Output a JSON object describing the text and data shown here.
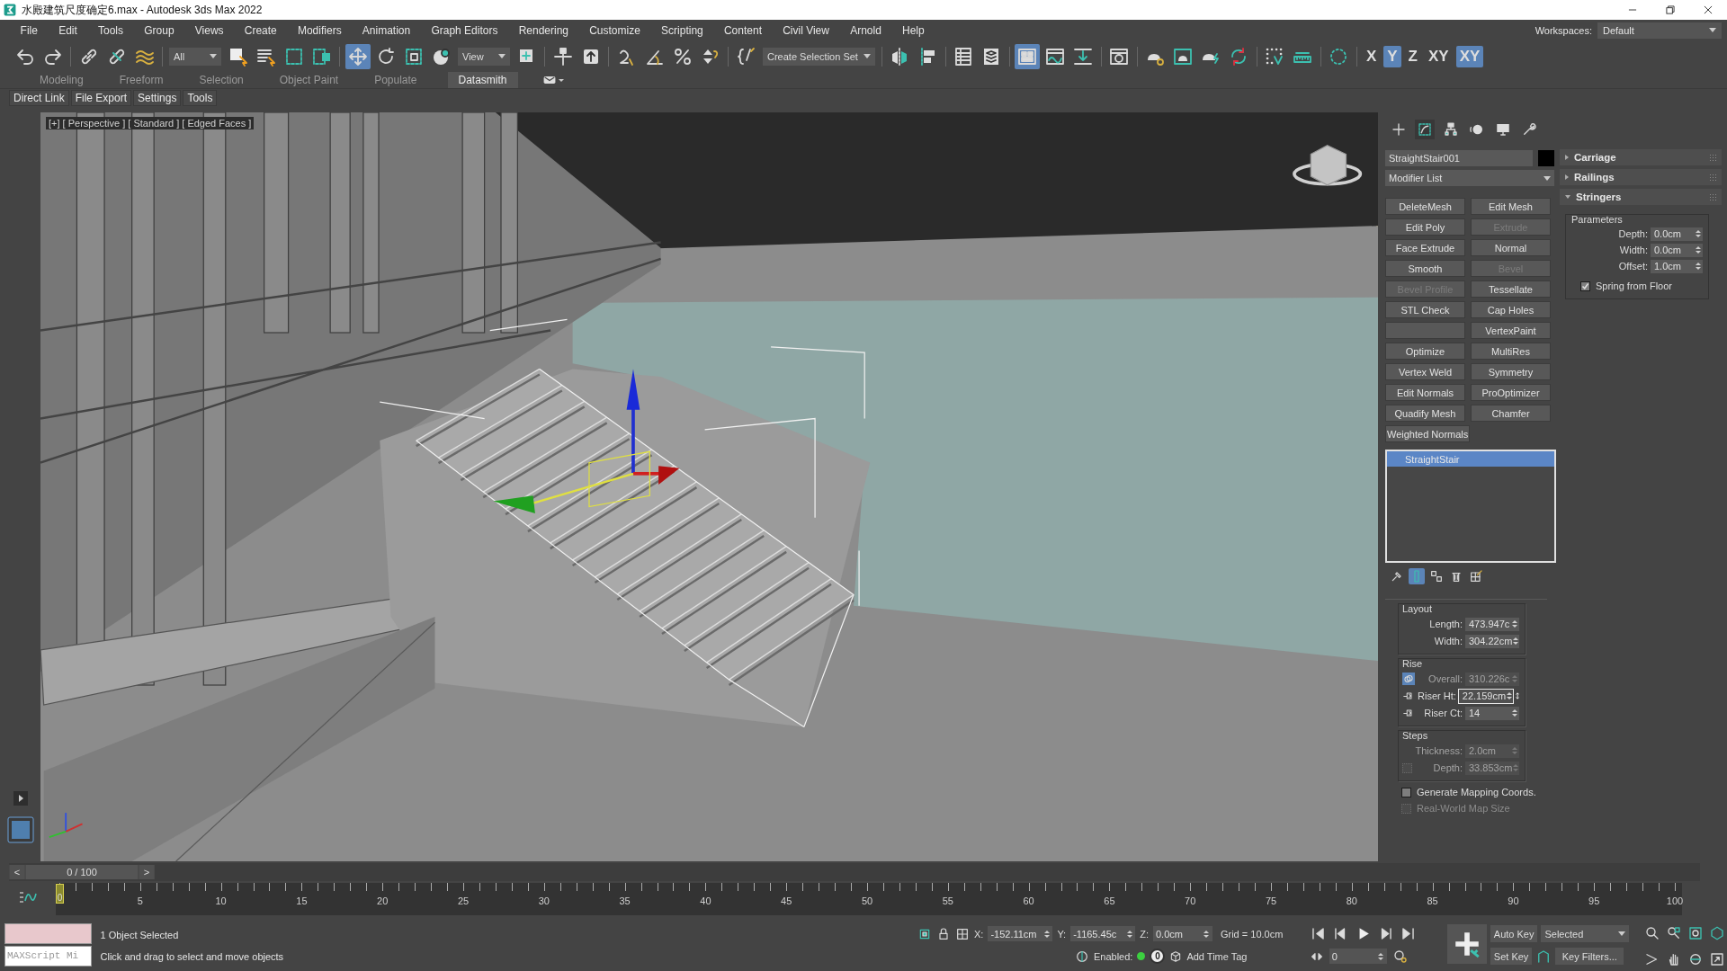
{
  "window": {
    "title": "水殿建筑尺度确定6.max - Autodesk 3ds Max 2022"
  },
  "menu": [
    "File",
    "Edit",
    "Tools",
    "Group",
    "Views",
    "Create",
    "Modifiers",
    "Animation",
    "Graph Editors",
    "Rendering",
    "Customize",
    "Scripting",
    "Content",
    "Civil View",
    "Arnold",
    "Help"
  ],
  "workspaces": {
    "label": "Workspaces:",
    "value": "Default"
  },
  "toolbar": [
    {
      "kind": "icon",
      "selected": false
    },
    {
      "kind": "icon",
      "selected": false
    },
    {
      "kind": "sep"
    },
    {
      "kind": "icon",
      "selected": false
    },
    {
      "kind": "icon",
      "selected": false
    },
    {
      "kind": "icon",
      "selected": false
    },
    {
      "kind": "sep"
    },
    {
      "kind": "dropdown",
      "value": "All"
    },
    {
      "kind": "icon",
      "selected": false
    },
    {
      "kind": "icon",
      "selected": false
    },
    {
      "kind": "icon",
      "selected": false
    },
    {
      "kind": "icon",
      "selected": false
    },
    {
      "kind": "sep"
    },
    {
      "kind": "icon",
      "selected": true
    },
    {
      "kind": "icon",
      "selected": false
    },
    {
      "kind": "icon",
      "selected": false
    },
    {
      "kind": "icon",
      "selected": false
    },
    {
      "kind": "dropdown",
      "value": "View"
    },
    {
      "kind": "icon",
      "selected": false
    },
    {
      "kind": "sep"
    },
    {
      "kind": "icon",
      "selected": false
    },
    {
      "kind": "icon",
      "selected": false
    },
    {
      "kind": "sep"
    },
    {
      "kind": "icon",
      "selected": false
    },
    {
      "kind": "icon",
      "selected": false
    },
    {
      "kind": "icon",
      "selected": false
    },
    {
      "kind": "icon",
      "selected": false
    },
    {
      "kind": "sep"
    },
    {
      "kind": "icon",
      "selected": false
    },
    {
      "kind": "dropdown",
      "value": "Create Selection Set"
    },
    {
      "kind": "sep"
    },
    {
      "kind": "icon",
      "selected": false
    },
    {
      "kind": "icon",
      "selected": false
    },
    {
      "kind": "sep"
    },
    {
      "kind": "icon",
      "selected": false
    },
    {
      "kind": "icon",
      "selected": false
    },
    {
      "kind": "sep"
    },
    {
      "kind": "icon",
      "selected": true
    },
    {
      "kind": "icon",
      "selected": false
    },
    {
      "kind": "icon",
      "selected": false
    },
    {
      "kind": "sep"
    },
    {
      "kind": "icon",
      "selected": false
    },
    {
      "kind": "sep"
    },
    {
      "kind": "icon",
      "selected": false
    },
    {
      "kind": "icon",
      "selected": false
    },
    {
      "kind": "icon",
      "selected": false
    },
    {
      "kind": "icon",
      "selected": false
    },
    {
      "kind": "sep"
    },
    {
      "kind": "icon",
      "selected": false
    },
    {
      "kind": "icon",
      "selected": false
    },
    {
      "kind": "sep"
    },
    {
      "kind": "icon",
      "selected": false
    },
    {
      "kind": "sep"
    },
    {
      "kind": "axis",
      "label": "X",
      "selected": false
    },
    {
      "kind": "axis",
      "label": "Y",
      "selected": true
    },
    {
      "kind": "axis",
      "label": "Z",
      "selected": false
    },
    {
      "kind": "axis",
      "label": "XY",
      "selected": false
    },
    {
      "kind": "axis",
      "label": "XY",
      "selected": true
    }
  ],
  "ribbon_tabs": [
    {
      "label": "Modeling",
      "selected": false
    },
    {
      "label": "Freeform",
      "selected": false
    },
    {
      "label": "Selection",
      "selected": false
    },
    {
      "label": "Object Paint",
      "selected": false
    },
    {
      "label": "Populate",
      "selected": false
    },
    {
      "label": "Datasmith",
      "selected": true
    }
  ],
  "datasmith_buttons": [
    "Direct Link",
    "File Export",
    "Settings",
    "Tools"
  ],
  "viewport": {
    "label": "[+] [ Perspective ] [ Standard ] [ Edged Faces ]"
  },
  "command_panel": {
    "tabs": [
      {
        "selected": false
      },
      {
        "selected": true
      },
      {
        "selected": false
      },
      {
        "selected": false
      },
      {
        "selected": false
      },
      {
        "selected": false
      }
    ],
    "object_name": "StraightStair001",
    "modifier_list": "Modifier List",
    "modifier_buttons": [
      {
        "kind": "button",
        "label": "DeleteMesh",
        "disabled": false
      },
      {
        "kind": "button",
        "label": "Edit Mesh",
        "disabled": false
      },
      {
        "kind": "button",
        "label": "Edit Poly",
        "disabled": false
      },
      {
        "kind": "button",
        "label": "Extrude",
        "disabled": true
      },
      {
        "kind": "button",
        "label": "Face Extrude",
        "disabled": false
      },
      {
        "kind": "button",
        "label": "Normal",
        "disabled": false
      },
      {
        "kind": "button",
        "label": "Smooth",
        "disabled": false
      },
      {
        "kind": "button",
        "label": "Bevel",
        "disabled": true
      },
      {
        "kind": "button",
        "label": "Bevel Profile",
        "disabled": true
      },
      {
        "kind": "button",
        "label": "Tessellate",
        "disabled": false
      },
      {
        "kind": "button",
        "label": "STL Check",
        "disabled": false
      },
      {
        "kind": "button",
        "label": "Cap Holes",
        "disabled": false
      },
      {
        "kind": "blank"
      },
      {
        "kind": "button",
        "label": "VertexPaint",
        "disabled": false
      },
      {
        "kind": "button",
        "label": "Optimize",
        "disabled": false
      },
      {
        "kind": "button",
        "label": "MultiRes",
        "disabled": false
      },
      {
        "kind": "button",
        "label": "Vertex Weld",
        "disabled": false
      },
      {
        "kind": "button",
        "label": "Symmetry",
        "disabled": false
      },
      {
        "kind": "button",
        "label": "Edit Normals",
        "disabled": false
      },
      {
        "kind": "button",
        "label": "ProOptimizer",
        "disabled": false
      },
      {
        "kind": "button",
        "label": "Quadify Mesh",
        "disabled": false
      },
      {
        "kind": "button",
        "label": "Chamfer",
        "disabled": false
      },
      {
        "kind": "button",
        "label": "Weighted Normals",
        "disabled": false
      }
    ],
    "stack": [
      {
        "label": "StraightStair",
        "selected": true
      }
    ],
    "stack_tools": [
      {
        "selected": false
      },
      {
        "selected": true
      },
      {
        "selected": false
      },
      {
        "selected": false
      },
      {
        "selected": false
      }
    ],
    "layout": {
      "title": "Layout",
      "fields": [
        {
          "label": "Length:",
          "value": "473.947c"
        },
        {
          "label": "Width:",
          "value": "304.22cm"
        }
      ]
    },
    "rise": {
      "title": "Rise",
      "fields": [
        {
          "label": "Overall:",
          "value": "310.226c",
          "disabled": true,
          "selected": true,
          "focused": false
        },
        {
          "label": "Riser Ht:",
          "value": "22.159cm",
          "disabled": false,
          "selected": false,
          "focused": true
        },
        {
          "label": "Riser Ct:",
          "value": "14",
          "disabled": false,
          "selected": false,
          "focused": false
        }
      ]
    },
    "steps": {
      "title": "Steps",
      "fields": [
        {
          "kind": "plain",
          "label": "Thickness:",
          "value": "2.0cm",
          "disabled": true
        },
        {
          "kind": "checkbox",
          "label": "Depth:",
          "value": "33.853cm",
          "disabled": true,
          "checked": false
        }
      ]
    },
    "options": [
      {
        "label": "Generate Mapping Coords.",
        "checked": false,
        "disabled": false
      },
      {
        "label": "Real-World Map Size",
        "checked": false,
        "disabled": true
      }
    ],
    "rollouts": [
      {
        "title": "Carriage",
        "expanded": false
      },
      {
        "title": "Railings",
        "expanded": false
      },
      {
        "title": "Stringers",
        "expanded": true,
        "group": "Parameters",
        "fields": [
          {
            "label": "Depth:",
            "value": "0.0cm"
          },
          {
            "label": "Width:",
            "value": "0.0cm"
          },
          {
            "label": "Offset:",
            "value": "1.0cm"
          }
        ],
        "options": [
          {
            "label": "Spring from Floor",
            "checked": true
          }
        ]
      }
    ]
  },
  "timeline": {
    "prev": "<",
    "frame": "0 / 100",
    "next": ">",
    "level": 0,
    "current": "0",
    "tick_labels": [
      "5",
      "10",
      "15",
      "20",
      "25",
      "30",
      "35",
      "40",
      "45",
      "50",
      "55",
      "60",
      "65",
      "70",
      "75",
      "80",
      "85",
      "90",
      "95",
      "100"
    ]
  },
  "status": {
    "listener_text": "MAXScript Mi",
    "selection": "1 Object Selected",
    "prompt": "Click and drag to select and move objects",
    "coords": [
      {
        "axis": "X:",
        "value": "-152.11cm"
      },
      {
        "axis": "Y:",
        "value": "-1165.45c"
      },
      {
        "axis": "Z:",
        "value": "0.0cm"
      }
    ],
    "grid": "Grid = 10.0cm",
    "enabled_label": "Enabled:",
    "enabled": true,
    "tag_count": "0",
    "add_time_tag": "Add Time Tag",
    "frame_field": "0",
    "auto_key": "Auto Key",
    "set_key": "Set Key",
    "key_mode": "Selected",
    "key_filters": "Key Filters..."
  }
}
